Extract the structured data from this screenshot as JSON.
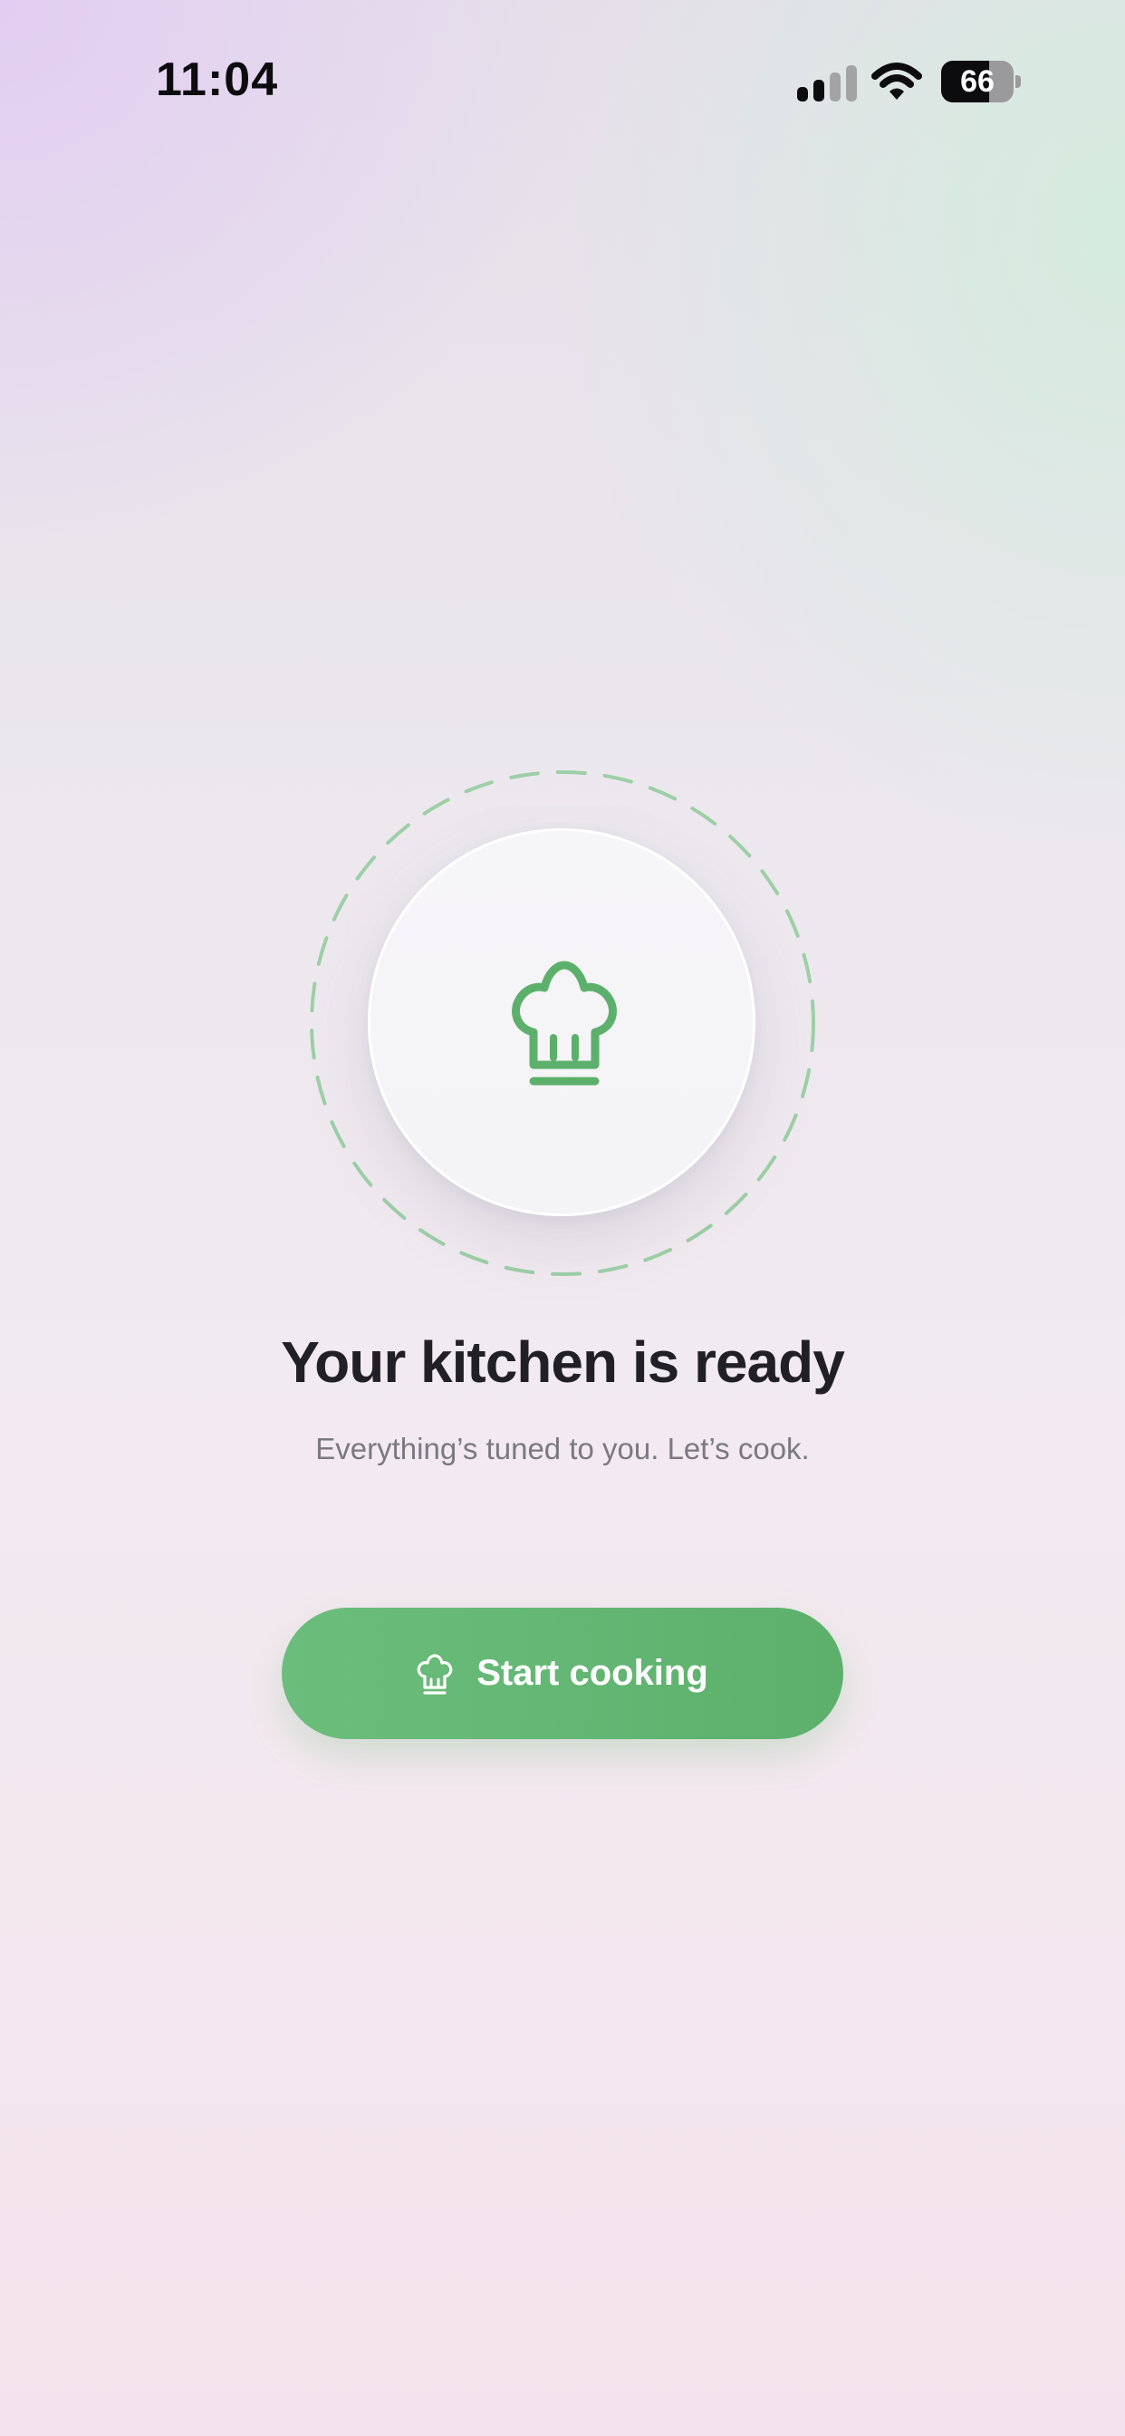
{
  "status_bar": {
    "time": "11:04",
    "battery_level": "66",
    "battery_fraction": 0.66,
    "signal_icon": "cellular-signal-icon",
    "wifi_icon": "wifi-icon",
    "battery_icon": "battery-icon"
  },
  "hero": {
    "icon": "chef-hat-icon",
    "accent_color": "#5cb06b",
    "title": "Your kitchen is ready",
    "subtitle": "Everything’s tuned to you. Let’s cook."
  },
  "cta": {
    "icon": "chef-hat-icon",
    "label": "Start cooking",
    "color": "#63b673"
  }
}
